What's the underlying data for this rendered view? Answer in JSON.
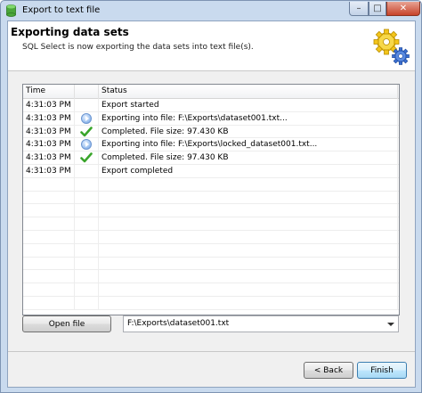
{
  "window": {
    "title": "Export to text file",
    "controls": {
      "minimize": "–",
      "maximize": "□",
      "close": "✕"
    }
  },
  "header": {
    "title": "Exporting data sets",
    "subtitle": "SQL Select is now exporting the data sets into text file(s)."
  },
  "log": {
    "columns": {
      "time": "Time",
      "icon": "",
      "status": "Status"
    },
    "rows": [
      {
        "time": "4:31:03 PM",
        "icon": "none",
        "status": "Export started"
      },
      {
        "time": "4:31:03 PM",
        "icon": "info",
        "status": "Exporting into file: F:\\Exports\\dataset001.txt..."
      },
      {
        "time": "4:31:03 PM",
        "icon": "check",
        "status": "Completed.  File size: 97.430 KB"
      },
      {
        "time": "4:31:03 PM",
        "icon": "info",
        "status": "Exporting into file: F:\\Exports\\locked_dataset001.txt..."
      },
      {
        "time": "4:31:03 PM",
        "icon": "check",
        "status": "Completed.  File size: 97.430 KB"
      },
      {
        "time": "4:31:03 PM",
        "icon": "none",
        "status": "Export completed"
      },
      {
        "time": "",
        "icon": "none",
        "status": ""
      },
      {
        "time": "",
        "icon": "none",
        "status": ""
      },
      {
        "time": "",
        "icon": "none",
        "status": ""
      },
      {
        "time": "",
        "icon": "none",
        "status": ""
      },
      {
        "time": "",
        "icon": "none",
        "status": ""
      },
      {
        "time": "",
        "icon": "none",
        "status": ""
      },
      {
        "time": "",
        "icon": "none",
        "status": ""
      },
      {
        "time": "",
        "icon": "none",
        "status": ""
      },
      {
        "time": "",
        "icon": "none",
        "status": ""
      },
      {
        "time": "",
        "icon": "none",
        "status": ""
      }
    ]
  },
  "controls": {
    "open_file_label": "Open file",
    "file_path_value": "F:\\Exports\\dataset001.txt",
    "back_label": "< Back",
    "finish_label": "Finish"
  },
  "colors": {
    "accent": "#3c7fb1",
    "check_green": "#3aa52b",
    "gear_yellow": "#f3c51b",
    "gear_blue": "#3b6fd1"
  }
}
